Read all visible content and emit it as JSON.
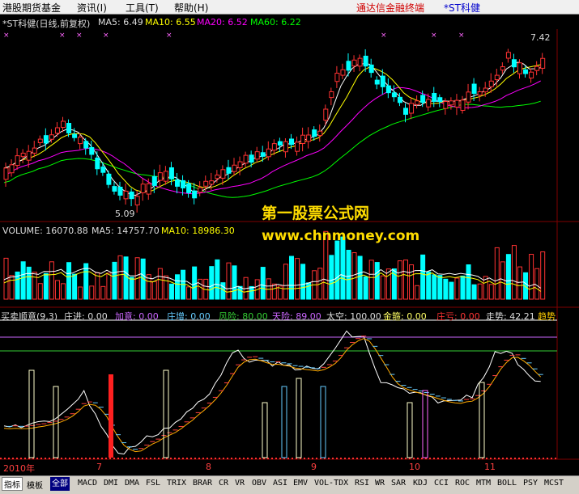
{
  "menubar": {
    "items": [
      "港股期货基金",
      "资讯(I)",
      "工具(T)",
      "帮助(H)"
    ],
    "app_title": "通达信金融终端",
    "stock_title": "*ST科健"
  },
  "price_panel": {
    "name": "*ST科健(日线,前复权)",
    "ma5": "MA5: 6.49",
    "ma10": "MA10: 6.55",
    "ma20": "MA20: 6.52",
    "ma60": "MA60: 6.22",
    "high_label": "7.42",
    "low_label": "5.09"
  },
  "watermark": {
    "line1": "第一股票公式网",
    "line2": "www.chnmoney.com"
  },
  "volume_panel": {
    "volume": "VOLUME: 16070.88",
    "ma5": "MA5: 14757.70",
    "ma10": "MA10: 18986.30"
  },
  "indicator_panel": {
    "name": "买卖顺意(9,3)",
    "items": [
      {
        "text": "庄进: 0.00",
        "color": "#dddddd"
      },
      {
        "text": "加意: 0.00",
        "color": "#cc66ff"
      },
      {
        "text": "庄增: 0.00",
        "color": "#66ccff"
      },
      {
        "text": "风险: 80.00",
        "color": "#33cc33"
      },
      {
        "text": "天险: 89.00",
        "color": "#cc66ff"
      },
      {
        "text": "太空: 100.00",
        "color": "#dddddd"
      },
      {
        "text": "金箍: 0.00",
        "color": "#ffff66"
      },
      {
        "text": "庄亏: 0.00",
        "color": "#ff3333"
      },
      {
        "text": "走势: 42.21",
        "color": "#dddddd"
      },
      {
        "text": "趋势",
        "color": "#ffcc00"
      }
    ]
  },
  "date_axis": {
    "labels": [
      "2010年",
      "7",
      "8",
      "9",
      "10",
      "11"
    ]
  },
  "tabs": {
    "items": [
      "指标",
      "模板",
      "全部",
      "MACD",
      "DMI",
      "DMA",
      "FSL",
      "TRIX",
      "BRAR",
      "CR",
      "VR",
      "OBV",
      "ASI",
      "EMV",
      "VOL-TDX",
      "RSI",
      "WR",
      "SAR",
      "KDJ",
      "CCI",
      "ROC",
      "MTM",
      "BOLL",
      "PSY",
      "MCST"
    ],
    "active": "全部"
  },
  "colors": {
    "up": "#ff3232",
    "down": "#00ffff",
    "ma5": "#ffffff",
    "ma10": "#ffff00",
    "ma20": "#ff00ff",
    "ma60": "#00ff00",
    "grid_red": "#800000"
  }
}
